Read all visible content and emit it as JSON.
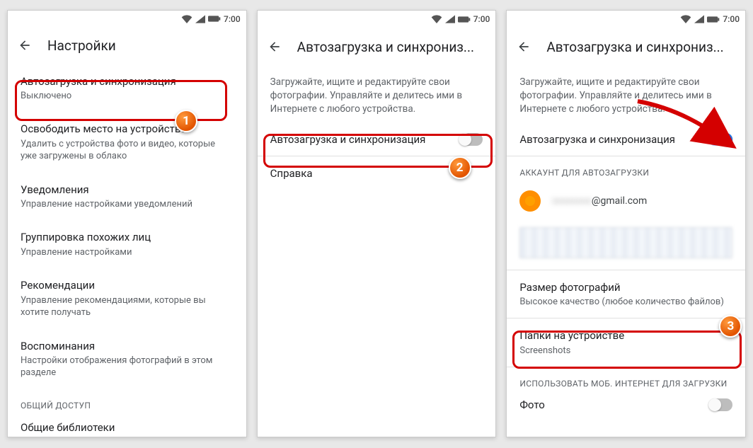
{
  "statusbar": {
    "time": "7:00"
  },
  "screen1": {
    "header": "Настройки",
    "items": [
      {
        "title": "Автозагрузка и синхронизация",
        "sub": "Выключено"
      },
      {
        "title": "Освободить место на устройстве",
        "sub": "Удалить с устройства фото и видео, которые уже загружены в облако"
      },
      {
        "title": "Уведомления",
        "sub": "Управление настройками уведомлений"
      },
      {
        "title": "Группировка похожих лиц",
        "sub": "Управление настройками"
      },
      {
        "title": "Рекомендации",
        "sub": "Управление рекомендациями, которые вы хотите получать"
      },
      {
        "title": "Воспоминания",
        "sub": "Настройки отображения фотографий в этом разделе"
      }
    ],
    "section": "ОБЩИЙ ДОСТУП",
    "shared_lib": "Общие библиотеки"
  },
  "screen2": {
    "header": "Автозагрузка и синхрониз...",
    "desc": "Загружайте, ищите и редактируйте свои фотографии. Управляйте и делитесь ими в Интернете с любого устройства.",
    "toggle_label": "Автозагрузка и синхронизация",
    "help": "Справка"
  },
  "screen3": {
    "header": "Автозагрузка и синхрониз...",
    "desc": "Загружайте, ищите и редактируйте свои фотографии. Управляйте и делитесь ими в Интернете с любого устройства.",
    "toggle_label": "Автозагрузка и синхронизация",
    "account_section": "АККАУНТ ДЛЯ АВТОЗАГРУЗКИ",
    "account_email_visible": "@gmail.com",
    "size_title": "Размер фотографий",
    "size_sub": "Высокое качество (любое количество файлов)",
    "folders_title": "Папки на устройстве",
    "folders_sub": "Screenshots",
    "mobile_section": "ИСПОЛЬЗОВАТЬ МОБ. ИНТЕРНЕТ ДЛЯ ЗАГРУЗКИ",
    "photo_label": "Фото"
  },
  "badges": {
    "b1": "1",
    "b2": "2",
    "b3": "3"
  }
}
